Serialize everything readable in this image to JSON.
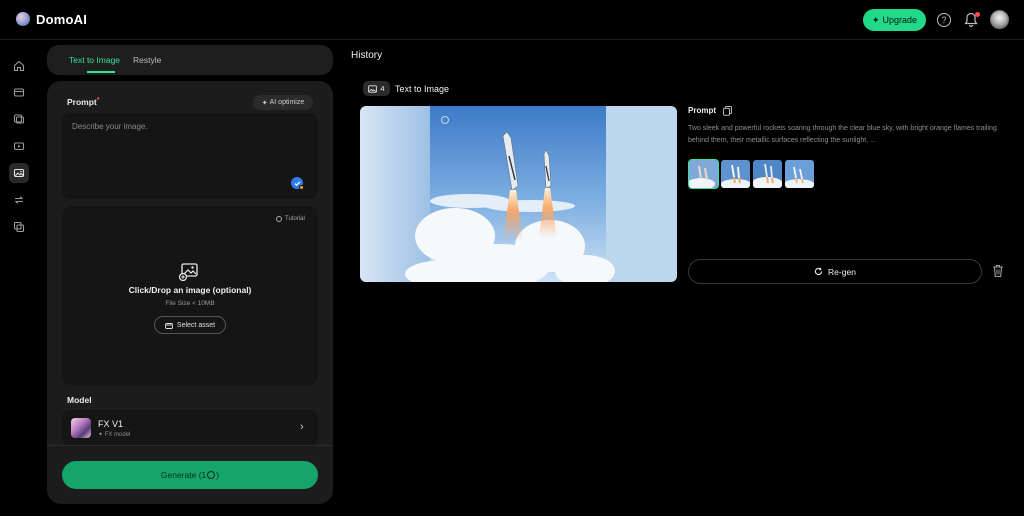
{
  "app": {
    "brand": "DomoAI"
  },
  "header": {
    "upgrade_label": "Upgrade"
  },
  "sidebar": {
    "items": [
      "home-icon",
      "box-icon",
      "layers-icon",
      "video-icon",
      "image-icon",
      "restyle-icon",
      "copy-icon"
    ]
  },
  "tabs": {
    "active": "Text to Image",
    "inactive": "Restyle"
  },
  "panel": {
    "prompt_label": "Prompt",
    "required_mark": "*",
    "ai_optimize": "AI optimize",
    "prompt_placeholder": "Describe your image.",
    "tutorial": "Tutorial",
    "upload_title": "Click/Drop an image (optional)",
    "upload_sub": "File Size < 10MB",
    "select_asset": "Select asset",
    "model_label": "Model",
    "model_name": "FX V1",
    "model_sub": "FX model",
    "generate_label": "Generate (1",
    "generate_suffix": ")"
  },
  "history": {
    "title": "History",
    "count": "4",
    "section": "Text to Image",
    "prompt_label": "Prompt",
    "prompt_text": "Two sleek and powerful rockets soaring through the clear blue sky, with bright orange flames trailing behind them, their metallic surfaces reflecting the sunlight, ...",
    "regen_label": "Re-gen",
    "thumbnails_count": 4,
    "selected_thumbnail": 1
  },
  "colors": {
    "accent": "#22d98a",
    "generate": "#15a569",
    "background": "#000000",
    "panel": "#1c1c1c"
  }
}
